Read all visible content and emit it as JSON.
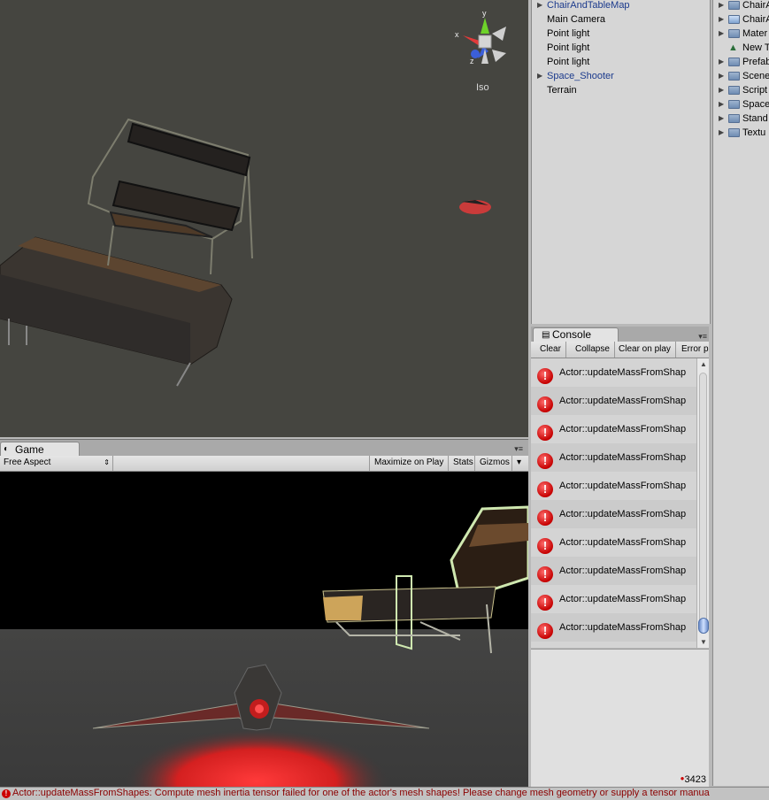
{
  "scene": {
    "projection_label": "Iso",
    "gizmo_axes": {
      "x": "x",
      "y": "y",
      "z": "z"
    }
  },
  "game": {
    "tab_label": "Game",
    "aspect": "Free Aspect",
    "toolbar": {
      "maximize": "Maximize on Play",
      "stats": "Stats",
      "gizmos": "Gizmos"
    }
  },
  "hierarchy": {
    "items": [
      {
        "label": "ChairAndTableMap",
        "expandable": true,
        "prefab": true
      },
      {
        "label": "Main Camera",
        "expandable": false,
        "prefab": false
      },
      {
        "label": "Point light",
        "expandable": false,
        "prefab": false
      },
      {
        "label": "Point light",
        "expandable": false,
        "prefab": false
      },
      {
        "label": "Point light",
        "expandable": false,
        "prefab": false
      },
      {
        "label": "Space_Shooter",
        "expandable": true,
        "prefab": true
      },
      {
        "label": "Terrain",
        "expandable": false,
        "prefab": false
      }
    ]
  },
  "console": {
    "tab_label": "Console",
    "toolbar": {
      "clear": "Clear",
      "collapse": "Collapse",
      "clear_on_play": "Clear on play",
      "error_pause": "Error p"
    },
    "entries": [
      "Actor::updateMassFromShap",
      "Actor::updateMassFromShap",
      "Actor::updateMassFromShap",
      "Actor::updateMassFromShap",
      "Actor::updateMassFromShap",
      "Actor::updateMassFromShap",
      "Actor::updateMassFromShap",
      "Actor::updateMassFromShap",
      "Actor::updateMassFromShap",
      "Actor::updateMassFromShap"
    ],
    "error_count": "3423"
  },
  "project": {
    "items": [
      {
        "label": "ChairA",
        "icon": "folder-icon"
      },
      {
        "label": "ChairA",
        "icon": "prefab-icon"
      },
      {
        "label": "Mater",
        "icon": "folder-icon"
      },
      {
        "label": "New T",
        "icon": "terrain-icon"
      },
      {
        "label": "Prefab",
        "icon": "folder-icon"
      },
      {
        "label": "Scene",
        "icon": "folder-icon"
      },
      {
        "label": "Script",
        "icon": "folder-icon"
      },
      {
        "label": "Space",
        "icon": "folder-icon"
      },
      {
        "label": "Stand",
        "icon": "folder-icon"
      },
      {
        "label": "Textu",
        "icon": "folder-icon"
      }
    ]
  },
  "statusbar": {
    "message": "Actor::updateMassFromShapes: Compute mesh inertia tensor failed for one of the actor's mesh shapes! Please change mesh geometry or supply a tensor manua"
  }
}
